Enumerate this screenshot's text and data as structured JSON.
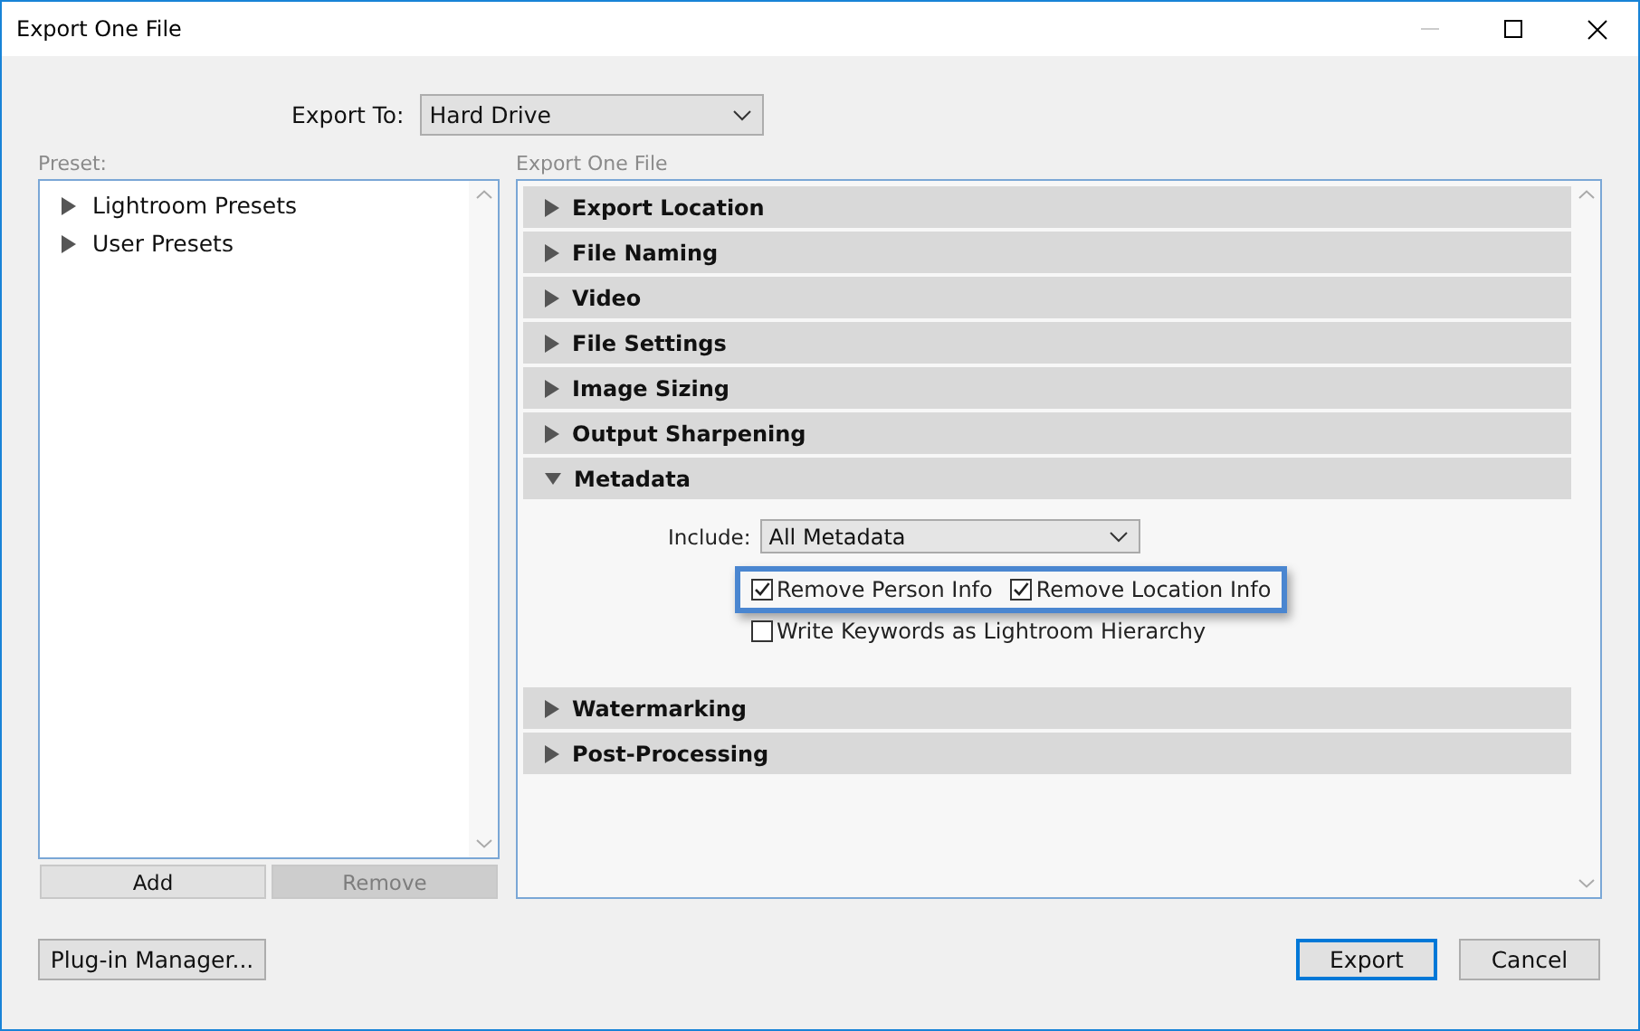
{
  "window": {
    "title": "Export One File",
    "minimize_disabled": true
  },
  "export_to": {
    "label": "Export To:",
    "value": "Hard Drive"
  },
  "preset": {
    "label": "Preset:",
    "items": [
      {
        "label": "Lightroom Presets",
        "expanded": false
      },
      {
        "label": "User Presets",
        "expanded": false
      }
    ],
    "buttons": [
      {
        "label": "Add",
        "disabled": false
      },
      {
        "label": "Remove",
        "disabled": true
      }
    ]
  },
  "panel": {
    "label": "Export One File",
    "sections": [
      {
        "title": "Export Location",
        "expanded": false
      },
      {
        "title": "File Naming",
        "expanded": false
      },
      {
        "title": "Video",
        "expanded": false
      },
      {
        "title": "File Settings",
        "expanded": false
      },
      {
        "title": "Image Sizing",
        "expanded": false
      },
      {
        "title": "Output Sharpening",
        "expanded": false
      },
      {
        "title": "Metadata",
        "expanded": true,
        "include": {
          "label": "Include:",
          "value": "All Metadata"
        },
        "option_rows": [
          {
            "highlighted": true,
            "options": [
              {
                "label": "Remove Person Info",
                "checked": true
              },
              {
                "label": "Remove Location Info",
                "checked": true
              }
            ]
          },
          {
            "highlighted": false,
            "options": [
              {
                "label": "Write Keywords as Lightroom Hierarchy",
                "checked": false
              }
            ]
          }
        ]
      },
      {
        "title": "Watermarking",
        "expanded": false
      },
      {
        "title": "Post-Processing",
        "expanded": false
      }
    ]
  },
  "footer": {
    "plugin_button": "Plug-in Manager...",
    "buttons": [
      {
        "label": "Export",
        "default": true
      },
      {
        "label": "Cancel",
        "default": false
      }
    ]
  }
}
